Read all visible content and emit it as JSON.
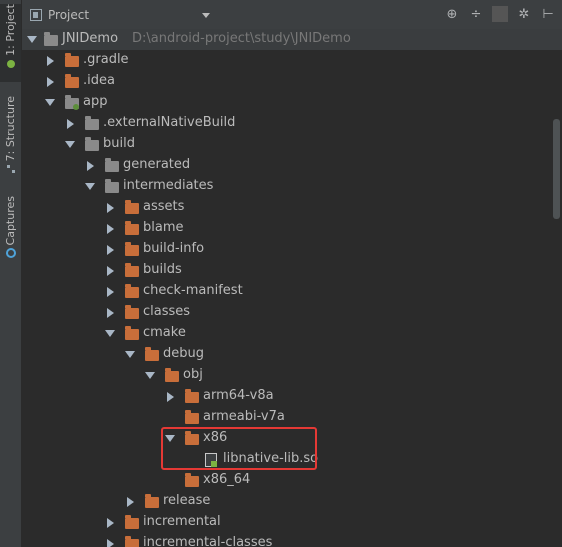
{
  "sidebar": {
    "tabs": [
      {
        "label": "1: Project",
        "active": true
      },
      {
        "label": "7: Structure",
        "active": false
      },
      {
        "label": "Captures",
        "active": false
      }
    ]
  },
  "header": {
    "title": "Project",
    "tools": [
      "locate-icon",
      "collapse-icon",
      "settings-icon",
      "hide-icon"
    ]
  },
  "tree": {
    "root": {
      "label": "JNIDemo",
      "path": "D:\\android-project\\study\\JNIDemo"
    },
    "items": [
      {
        "label": ".gradle"
      },
      {
        "label": ".idea"
      },
      {
        "label": "app"
      },
      {
        "label": ".externalNativeBuild"
      },
      {
        "label": "build"
      },
      {
        "label": "generated"
      },
      {
        "label": "intermediates"
      },
      {
        "label": "assets"
      },
      {
        "label": "blame"
      },
      {
        "label": "build-info"
      },
      {
        "label": "builds"
      },
      {
        "label": "check-manifest"
      },
      {
        "label": "classes"
      },
      {
        "label": "cmake"
      },
      {
        "label": "debug"
      },
      {
        "label": "obj"
      },
      {
        "label": "arm64-v8a"
      },
      {
        "label": "armeabi-v7a"
      },
      {
        "label": "x86"
      },
      {
        "label": "libnative-lib.so"
      },
      {
        "label": "x86_64"
      },
      {
        "label": "release"
      },
      {
        "label": "incremental"
      },
      {
        "label": "incremental-classes"
      }
    ]
  },
  "colors": {
    "folder": "#c86e3a",
    "highlight": "#e53935",
    "background": "#2b2b2b"
  }
}
